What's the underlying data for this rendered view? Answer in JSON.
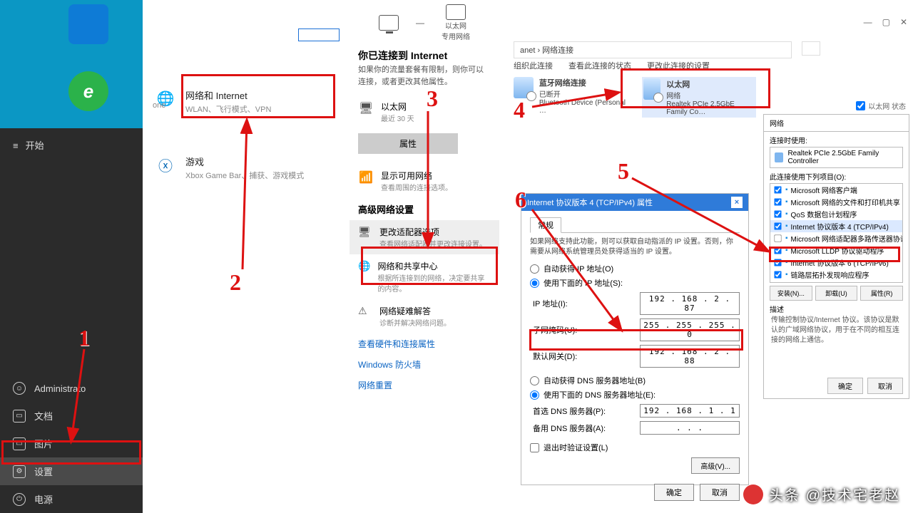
{
  "startmenu": {
    "header": "开始",
    "items": {
      "admin": "Administrato",
      "docs": "文档",
      "pics": "图片",
      "settings": "设置",
      "power": "电源"
    }
  },
  "settings": {
    "sidebar_label": "one",
    "cat_net": {
      "title": "网络和 Internet",
      "sub": "WLAN、飞行模式、VPN"
    },
    "cat_game": {
      "title": "游戏",
      "sub": "Xbox Game Bar、捕获、游戏模式"
    }
  },
  "ethernet": {
    "dev_eth": "以太网",
    "dev_priv": "专用网络",
    "headline": "你已连接到 Internet",
    "headline_sub": "如果你的流量套餐有限制，则你可以连接，或者更改其他属性。",
    "item_eth": {
      "t": "以太网",
      "s": "最近 30 天"
    },
    "btn_prop": "属性",
    "item_disp": {
      "t": "显示可用网络",
      "s": "查看周围的连接选项。"
    },
    "adv_title": "高级网络设置",
    "adv_adapter": {
      "t": "更改适配器选项",
      "s": "查看网络适配器并更改连接设置。"
    },
    "adv_share": {
      "t": "网络和共享中心",
      "s": "根据所连接到的网络，决定要共享的内容。"
    },
    "adv_trouble": {
      "t": "网络疑难解答",
      "s": "诊断并解决网络问题。"
    },
    "link_hw": "查看硬件和连接属性",
    "link_fw": "Windows 防火墙",
    "link_reset": "网络重置"
  },
  "explorer": {
    "crumb": "anet  ›  网络连接",
    "tb1": "组织此连接",
    "tb2": "查看此连接的状态",
    "tb3": "更改此连接的设置",
    "conn_bt": {
      "name": "蓝牙网络连接",
      "state": "已断开",
      "dev": "Bluetooth Device (Personal …"
    },
    "conn_eth": {
      "name": "以太网",
      "state": "网络",
      "dev": "Realtek PCIe 2.5GbE Family Co…"
    }
  },
  "ethprops": {
    "tab": "网络",
    "conn_label": "连接时使用:",
    "conn_dev": "Realtek PCIe 2.5GbE Family Controller",
    "list_label": "此连接使用下列项目(O):",
    "items": [
      "Microsoft 网络客户端",
      "Microsoft 网络的文件和打印机共享",
      "QoS 数据包计划程序",
      "Internet 协议版本 4 (TCP/IPv4)",
      "Microsoft 网络适配器多路传送器协议",
      "Microsoft LLDP 协议驱动程序",
      "Internet 协议版本 6 (TCP/IPv6)",
      "链路层拓扑发现响应程序"
    ],
    "btn_install": "安装(N)...",
    "btn_uninstall": "卸载(U)",
    "btn_props": "属性(R)",
    "desc_label": "描述",
    "desc": "传输控制协议/Internet 协议。该协议是默认的广域网络协议，用于在不同的相互连接的网络上通信。",
    "ok": "确定",
    "cancel": "取消",
    "status_hint": "以太网 状态"
  },
  "ipv4": {
    "title": "Internet 协议版本 4 (TCP/IPv4) 属性",
    "tab": "常规",
    "hint": "如果网络支持此功能，则可以获取自动指派的 IP 设置。否则，你需要从网络系统管理员处获得适当的 IP 设置。",
    "r_auto_ip": "自动获得 IP 地址(O)",
    "r_man_ip": "使用下面的 IP 地址(S):",
    "ip_label": "IP 地址(I):",
    "ip_val": "192 . 168 .  2  . 87",
    "mask_label": "子网掩码(U):",
    "mask_val": "255 . 255 . 255 .  0",
    "gw_label": "默认网关(D):",
    "gw_val": "192 . 168 .  2  . 88",
    "r_auto_dns": "自动获得 DNS 服务器地址(B)",
    "r_man_dns": "使用下面的 DNS 服务器地址(E):",
    "dns1_label": "首选 DNS 服务器(P):",
    "dns1_val": "192 . 168 .  1  .  1",
    "dns2_label": "备用 DNS 服务器(A):",
    "dns2_val": " .  .  . ",
    "chk_validate": "退出时验证设置(L)",
    "btn_adv": "高级(V)...",
    "ok": "确定",
    "cancel": "取消"
  },
  "annotations": {
    "n1": "1",
    "n2": "2",
    "n3": "3",
    "n4": "4",
    "n5": "5",
    "n6": "6"
  },
  "watermark": "头条 @技术宅老赵"
}
